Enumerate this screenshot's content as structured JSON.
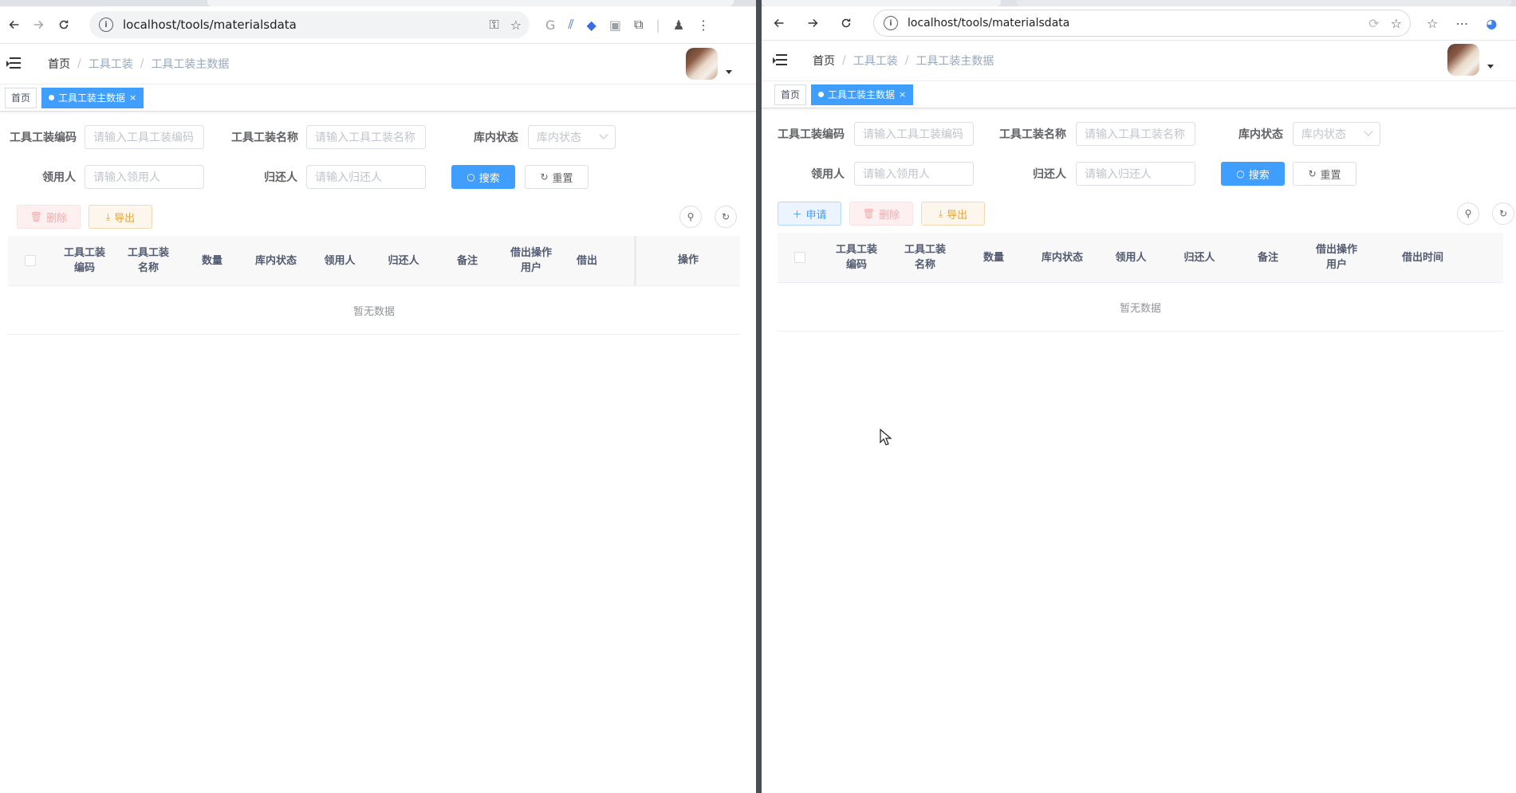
{
  "browser_left": {
    "url": "localhost/tools/materialsdata"
  },
  "browser_right": {
    "url": "localhost/tools/materialsdata"
  },
  "breadcrumb": [
    "首页",
    "工具工装",
    "工具工装主数据"
  ],
  "tags": {
    "home": "首页",
    "active": "工具工装主数据",
    "close": "×"
  },
  "filters": {
    "code_label": "工具工装编码",
    "code_placeholder": "请输入工具工装编码",
    "name_label": "工具工装名称",
    "name_placeholder": "请输入工具工装名称",
    "status_label": "库内状态",
    "status_placeholder": "库内状态",
    "borrower_label": "领用人",
    "borrower_placeholder": "请输入领用人",
    "returner_label": "归还人",
    "returner_placeholder": "请输入归还人",
    "search": "搜索",
    "reset": "重置"
  },
  "actions": {
    "apply": "申请",
    "delete": "删除",
    "export": "导出"
  },
  "table_left": {
    "columns": [
      "工具工装\n编码",
      "工具工装\n名称",
      "数量",
      "库内状态",
      "领用人",
      "归还人",
      "备注",
      "借出操作\n用户",
      "借出",
      "操作"
    ],
    "empty": "暂无数据"
  },
  "table_right": {
    "columns": [
      "工具工装\n编码",
      "工具工装\n名称",
      "数量",
      "库内状态",
      "领用人",
      "归还人",
      "备注",
      "借出操作\n用户",
      "借出时间"
    ],
    "empty": "暂无数据"
  },
  "colors": {
    "primary": "#409eff",
    "danger_plain": "#fef0f0",
    "warning": "#e6a23c"
  }
}
